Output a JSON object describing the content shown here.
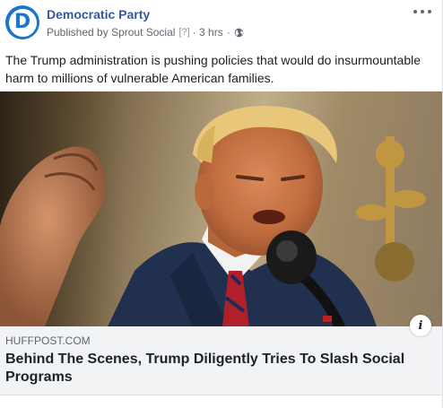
{
  "post": {
    "page_name": "Democratic Party",
    "published_by_prefix": "Published by",
    "publisher": "Sprout Social",
    "help_marker": "[?]",
    "separator": "·",
    "time": "3 hrs",
    "avatar_letter": "D",
    "text": "The Trump administration is pushing policies that would do insurmountable harm to millions of vulnerable American families."
  },
  "link_preview": {
    "domain": "HUFFPOST.COM",
    "headline": "Behind The Scenes, Trump Diligently Tries To Slash Social Programs"
  },
  "icons": {
    "avatar": "democratic-party-logo",
    "more": "more-options-icon",
    "audience": "globe-icon",
    "info": "info-icon"
  },
  "colors": {
    "brand_blue": "#1a75cf",
    "link_blue": "#385898",
    "meta_gray": "#606770",
    "preview_bg": "#f2f3f5"
  }
}
